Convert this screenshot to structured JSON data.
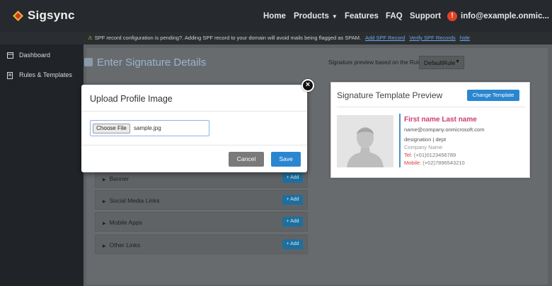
{
  "brand": {
    "name": "Sigsync",
    "icon": "sigsync-logo-icon",
    "accent": "#e24127"
  },
  "nav": {
    "home": "Home",
    "products": "Products",
    "features": "Features",
    "faq": "FAQ",
    "support": "Support",
    "alert_icon": "!",
    "user": "info@example.onmic..."
  },
  "spf": {
    "message": "SPF record configuration is pending?. Adding SPF record to your domain will avoid mails being flagged as SPAM.",
    "add_link": "Add SPF Record",
    "verify_link": "Verify SPF Records",
    "hide_link": "hide"
  },
  "sidebar": {
    "items": [
      {
        "label": "Dashboard",
        "icon": "dashboard-icon"
      },
      {
        "label": "Rules & Templates",
        "icon": "document-icon"
      }
    ]
  },
  "main": {
    "title": "Enter Signature Details",
    "sections": [
      {
        "label": "Banner",
        "add": "+ Add"
      },
      {
        "label": "Social Media Links",
        "add": "+ Add"
      },
      {
        "label": "Mobile Apps",
        "add": "+ Add"
      },
      {
        "label": "Other Links",
        "add": "+ Add"
      }
    ],
    "rule_label": "Signature preview based on the Rule",
    "rule_value": "DefaultRule"
  },
  "preview": {
    "title": "Signature Template Preview",
    "change_button": "Change Template",
    "name": "First name Last name",
    "email": "name@company.onmicrosoft.com",
    "designation": "designation | dept",
    "company": "Company Name",
    "tel_label": "Tel:",
    "tel": "(+01)0123456789",
    "mobile_label": "Mobile:",
    "mobile": "(+02)7896543210"
  },
  "modal": {
    "title": "Upload Profile Image",
    "choose_button": "Choose File",
    "file_name": "sample.jpg",
    "cancel": "Cancel",
    "save": "Save",
    "close": "×"
  }
}
